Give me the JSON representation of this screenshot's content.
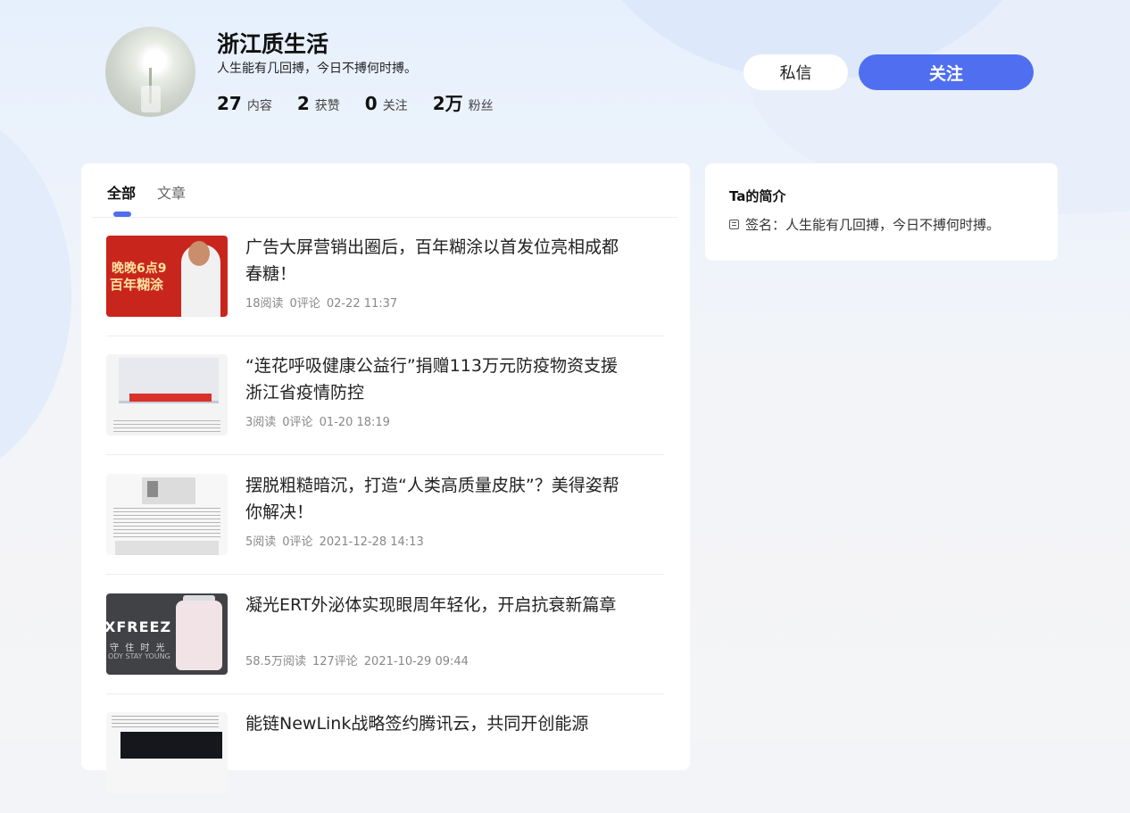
{
  "profile": {
    "name": "浙江质生活",
    "bio": "人生能有几回搏，今日不搏何时搏。",
    "stats": [
      {
        "value": "27",
        "label": "内容"
      },
      {
        "value": "2",
        "label": "获赞"
      },
      {
        "value": "0",
        "label": "关注"
      },
      {
        "value": "2万",
        "label": "粉丝"
      }
    ]
  },
  "actions": {
    "message_label": "私信",
    "follow_label": "关注"
  },
  "tabs": [
    {
      "label": "全部",
      "active": true
    },
    {
      "label": "文章",
      "active": false
    }
  ],
  "articles": [
    {
      "title": "广告大屏营销出圈后，百年糊涂以首发位亮相成都春糖！",
      "reads": "18阅读",
      "comments": "0评论",
      "time": "02-22 11:37"
    },
    {
      "title": "“连花呼吸健康公益行”捐赠113万元防疫物资支援浙江省疫情防控",
      "reads": "3阅读",
      "comments": "0评论",
      "time": "01-20 18:19"
    },
    {
      "title": "摆脱粗糙暗沉，打造“人类高质量皮肤”？美得姿帮你解决！",
      "reads": "5阅读",
      "comments": "0评论",
      "time": "2021-12-28 14:13"
    },
    {
      "title": "凝光ERT外泌体实现眼周年轻化，开启抗衰新篇章",
      "reads": "58.5万阅读",
      "comments": "127评论",
      "time": "2021-10-29 09:44"
    },
    {
      "title": "能链NewLink战略签约腾讯云，共同开创能源",
      "reads": "",
      "comments": "",
      "time": ""
    }
  ],
  "thumbs": {
    "t1_line1": "晚晚6点9",
    "t1_line2": "百年糊涂",
    "t4_logo": "XFREEZ",
    "t4_sub1": "守 住 时 光",
    "t4_sub2": "ODY STAY YOUNG"
  },
  "sidebar": {
    "title": "Ta的简介",
    "signature": "签名：人生能有几回搏，今日不搏何时搏。"
  },
  "colors": {
    "accent": "#4f6ff0",
    "background": "#f3f4f7"
  }
}
